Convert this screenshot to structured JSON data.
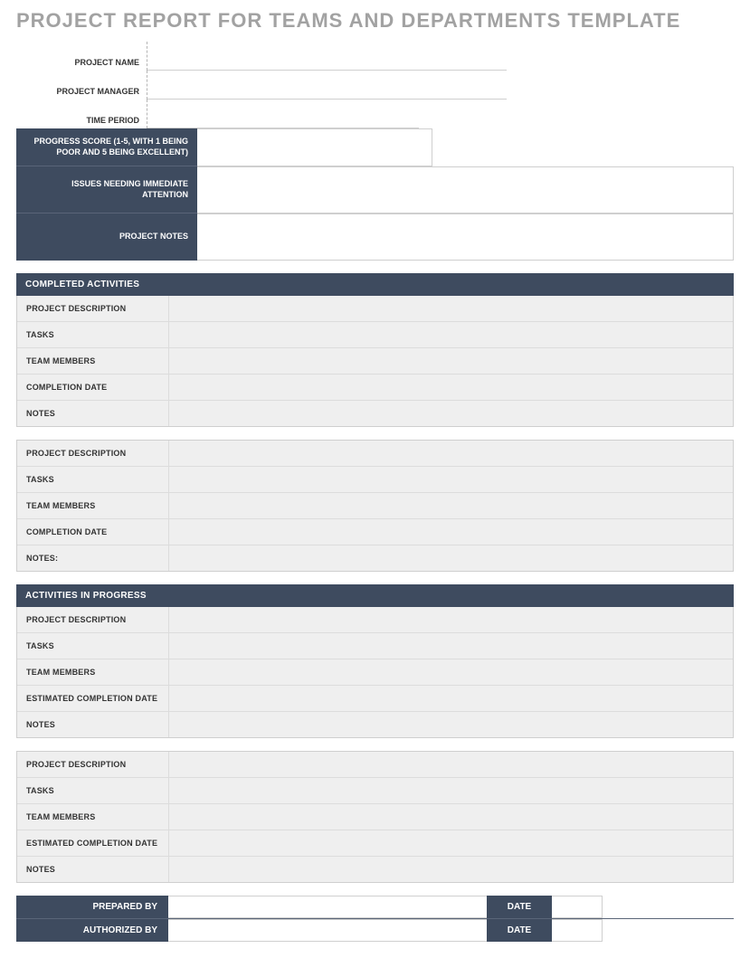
{
  "title": "PROJECT REPORT FOR TEAMS AND DEPARTMENTS TEMPLATE",
  "top": {
    "project_name": "PROJECT NAME",
    "project_manager": "PROJECT MANAGER",
    "time_period": "TIME PERIOD"
  },
  "dark_rows": {
    "progress_score": "PROGRESS SCORE (1-5, WITH 1 BEING POOR AND 5 BEING EXCELLENT)",
    "issues": "ISSUES NEEDING IMMEDIATE ATTENTION",
    "notes": "PROJECT NOTES"
  },
  "sections": {
    "completed": "COMPLETED ACTIVITIES",
    "in_progress": "ACTIVITIES IN PROGRESS"
  },
  "completed_block1": {
    "project_description": "PROJECT DESCRIPTION",
    "tasks": "TASKS",
    "team_members": "TEAM MEMBERS",
    "completion_date": "COMPLETION DATE",
    "notes": "NOTES"
  },
  "completed_block2": {
    "project_description": "PROJECT DESCRIPTION",
    "tasks": "TASKS",
    "team_members": "TEAM MEMBERS",
    "completion_date": "COMPLETION DATE",
    "notes": "NOTES:"
  },
  "progress_block1": {
    "project_description": "PROJECT DESCRIPTION",
    "tasks": "TASKS",
    "team_members": "TEAM MEMBERS",
    "estimated_completion_date": "ESTIMATED COMPLETION DATE",
    "notes": "NOTES"
  },
  "progress_block2": {
    "project_description": "PROJECT DESCRIPTION",
    "tasks": "TASKS",
    "team_members": "TEAM MEMBERS",
    "estimated_completion_date": "ESTIMATED COMPLETION DATE",
    "notes": "NOTES"
  },
  "footer": {
    "prepared_by": "PREPARED BY",
    "authorized_by": "AUTHORIZED BY",
    "date": "DATE"
  }
}
